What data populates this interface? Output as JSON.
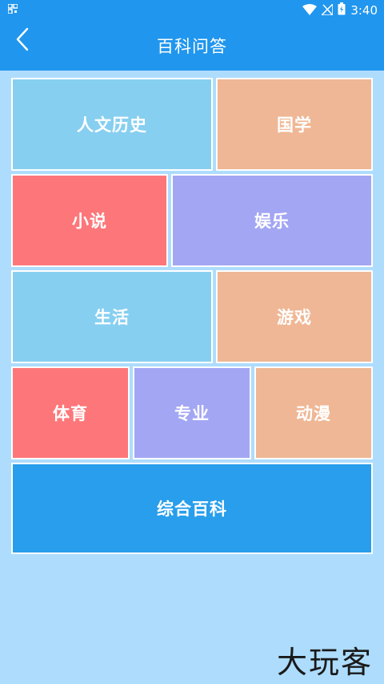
{
  "status_bar": {
    "time": "3:40",
    "left_icon": "qr-icon"
  },
  "header": {
    "title": "百科问答",
    "back_icon": "chevron-left-icon"
  },
  "categories": [
    {
      "label": "人文历史",
      "color": "#87cff0"
    },
    {
      "label": "国学",
      "color": "#efb795"
    },
    {
      "label": "小说",
      "color": "#fd777a"
    },
    {
      "label": "娱乐",
      "color": "#a3a6f3"
    },
    {
      "label": "生活",
      "color": "#87cff0"
    },
    {
      "label": "游戏",
      "color": "#efb795"
    },
    {
      "label": "体育",
      "color": "#fd777a"
    },
    {
      "label": "专业",
      "color": "#a3a6f3"
    },
    {
      "label": "动漫",
      "color": "#efb795"
    },
    {
      "label": "综合百科",
      "color": "#289eec"
    }
  ],
  "watermark": "大玩客",
  "colors": {
    "primary": "#2196ee",
    "background": "#aedcfd"
  }
}
